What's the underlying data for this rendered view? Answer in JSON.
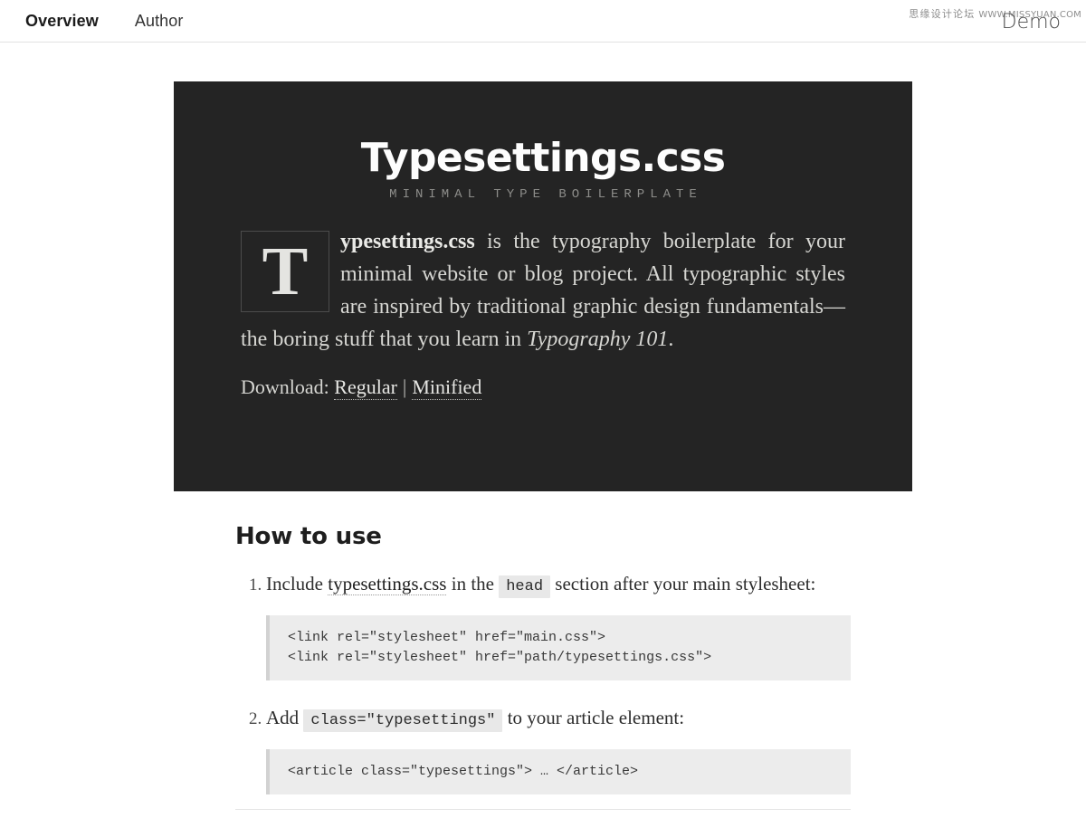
{
  "nav": {
    "items": [
      {
        "label": "Overview",
        "active": true
      },
      {
        "label": "Author",
        "active": false
      }
    ],
    "watermark_cn": "思缘设计论坛",
    "watermark_url": "WWW.MISSYUAN.COM",
    "demo_label": "Demo"
  },
  "hero": {
    "title": "Typesettings.css",
    "subtitle": "MINIMAL TYPE BOILERPLATE",
    "dropcap": "T",
    "lead_bold": "ypesettings.css",
    "body_part1": " is the typography boilerplate for your minimal website or blog project. All typographic styles are inspired by traditional graphic design fundamentals—the boring stuff that you learn in ",
    "body_italic": "Typography 101",
    "body_part2": ".",
    "download_label": "Download:",
    "download_regular": "Regular",
    "download_separator": "|",
    "download_minified": "Minified",
    "background_color": "#242424",
    "text_color": "#d6d6d2"
  },
  "content": {
    "heading": "How to use",
    "steps": [
      {
        "text_before": "Include ",
        "link": "typesettings.css",
        "text_middle": " in the ",
        "code": "head",
        "text_after": " section after your main stylesheet:",
        "codeblock": "<link rel=\"stylesheet\" href=\"main.css\">\n<link rel=\"stylesheet\" href=\"path/typesettings.css\">"
      },
      {
        "text_before": "Add ",
        "code": "class=\"typesettings\"",
        "text_after": " to your article element:",
        "codeblock": "<article class=\"typesettings\"> … </article>"
      }
    ]
  }
}
